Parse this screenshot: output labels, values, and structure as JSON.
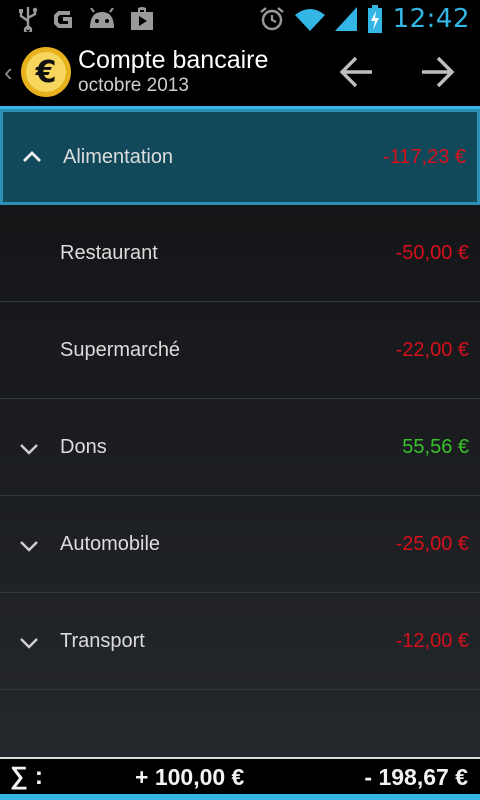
{
  "status_bar": {
    "time": "12:42",
    "icons": [
      "usb-icon",
      "g-icon",
      "android-icon",
      "play-store-icon",
      "alarm-icon",
      "wifi-icon",
      "signal-icon",
      "battery-charging-icon"
    ]
  },
  "action_bar": {
    "title": "Compte bancaire",
    "subtitle": "octobre 2013",
    "back_glyph": "‹",
    "logo_symbol": "€",
    "prev_icon": "arrow-left-icon",
    "next_icon": "arrow-right-icon"
  },
  "categories": [
    {
      "label": "Alimentation",
      "amount": "-117,23 €",
      "expander": "chevron-up-icon",
      "sign": "negative"
    },
    {
      "label": "Restaurant",
      "amount": "-50,00 €",
      "expander": "",
      "sign": "negative"
    },
    {
      "label": "Supermarché",
      "amount": "-22,00 €",
      "expander": "",
      "sign": "negative"
    },
    {
      "label": "Dons",
      "amount": "55,56 €",
      "expander": "chevron-down-icon",
      "sign": "positive"
    },
    {
      "label": "Automobile",
      "amount": "-25,00 €",
      "expander": "chevron-down-icon",
      "sign": "negative"
    },
    {
      "label": "Transport",
      "amount": "-12,00 €",
      "expander": "chevron-down-icon",
      "sign": "negative"
    }
  ],
  "footer": {
    "sigma": "∑ :",
    "income_total": "+ 100,00 €",
    "expense_total": "- 198,67 €"
  },
  "colors": {
    "accent": "#33b5e5",
    "negative": "#d6101a",
    "positive": "#39c12a",
    "selected_bg": "#12495a"
  }
}
